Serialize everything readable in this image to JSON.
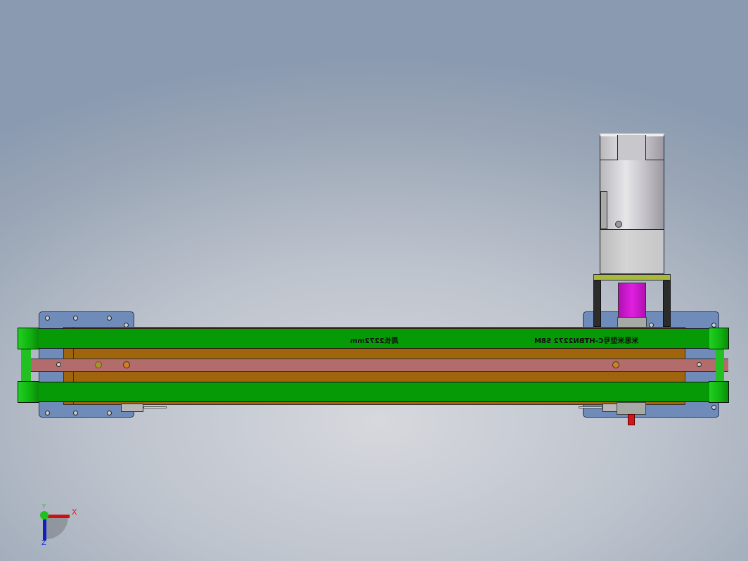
{
  "belt_labels": {
    "perimeter": "周长2272mm",
    "model": "米思米型号C-HTBN2272 S8M"
  },
  "triad": {
    "x_label": "X",
    "y_label": "Y",
    "z_label": "Z"
  },
  "colors": {
    "belt": "#069a06",
    "frame": "#a0650c",
    "plate": "#6f8bb9",
    "bar": "#b26c6c",
    "coupling": "#d010d0"
  }
}
